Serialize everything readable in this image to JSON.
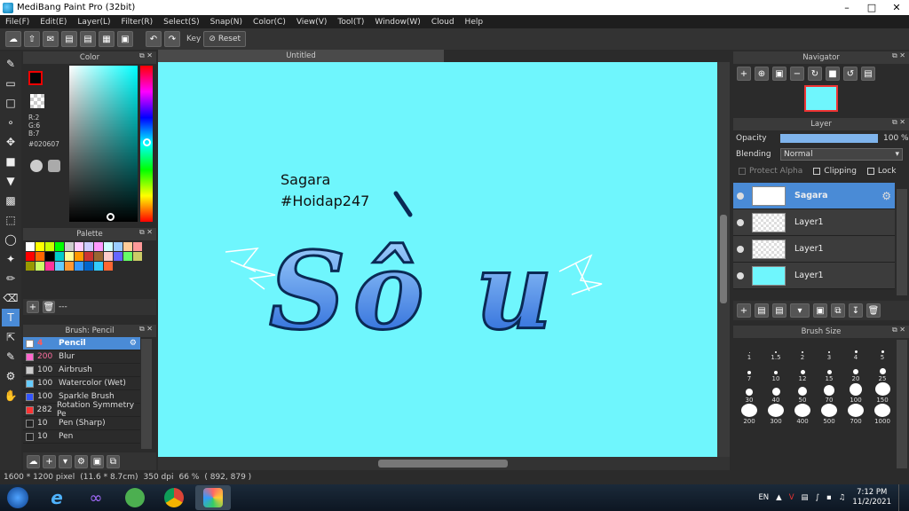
{
  "window": {
    "title": "MediBang Paint Pro (32bit)"
  },
  "menu": [
    "File(F)",
    "Edit(E)",
    "Layer(L)",
    "Filter(R)",
    "Select(S)",
    "Snap(N)",
    "Color(C)",
    "View(V)",
    "Tool(T)",
    "Window(W)",
    "Cloud",
    "Help"
  ],
  "toolbar": {
    "key_label": "Key",
    "reset_label": "Reset"
  },
  "color_panel": {
    "title": "Color",
    "r": "R:2",
    "g": "G:6",
    "b": "B:7",
    "hex": "#020607",
    "fg_color": "#020607"
  },
  "palette_panel": {
    "title": "Palette",
    "footer": "---",
    "swatches": [
      "#ffffff",
      "#ffff00",
      "#ccff00",
      "#00ff00",
      "#cccccc",
      "#ffccff",
      "#ccccff",
      "#ff99ff",
      "#ccffff",
      "#99ccff",
      "#ffcc99",
      "#ff9999",
      "#ff0000",
      "#ff6600",
      "#000000",
      "#00cccc",
      "#ffff99",
      "#ff9900",
      "#cc3333",
      "#996633",
      "#ffcccc",
      "#6666ff",
      "#66ff66",
      "#cccc66",
      "#999900",
      "#ccff66",
      "#ff3399",
      "#66ccff",
      "#ff9933",
      "#3399ff",
      "#0066cc",
      "#33ccff",
      "#ff6633"
    ]
  },
  "brush_panel": {
    "title": "Brush: Pencil",
    "brushes": [
      {
        "size": "4",
        "name": "Pencil",
        "color": "#ffffff"
      },
      {
        "size": "200",
        "name": "Blur",
        "color": "#ff66cc"
      },
      {
        "size": "100",
        "name": "Airbrush",
        "color": "#cccccc"
      },
      {
        "size": "100",
        "name": "Watercolor (Wet)",
        "color": "#66ccff"
      },
      {
        "size": "100",
        "name": "Sparkle Brush",
        "color": "#3355ff"
      },
      {
        "size": "282",
        "name": "Rotation Symmetry Pe",
        "color": "#ff3333"
      },
      {
        "size": "10",
        "name": "Pen (Sharp)",
        "color": "#222222"
      },
      {
        "size": "10",
        "name": "Pen",
        "color": "#222222"
      }
    ]
  },
  "canvas": {
    "tab": "Untitled",
    "bg_color": "#6ff6fd",
    "text_line1": "Sagara",
    "text_line2": "#Hoidap247",
    "art_text": "Sô u"
  },
  "navigator": {
    "title": "Navigator"
  },
  "layer_panel": {
    "title": "Layer",
    "opacity_label": "Opacity",
    "opacity_value": "100 %",
    "opacity": 1.0,
    "blending_label": "Blending",
    "blending_value": "Normal",
    "protect_alpha": "Protect Alpha",
    "clipping": "Clipping",
    "lock": "Lock",
    "layers": [
      {
        "name": "Sagara"
      },
      {
        "name": "Layer1"
      },
      {
        "name": "Layer1"
      },
      {
        "name": "Layer1"
      }
    ]
  },
  "brush_size_panel": {
    "title": "Brush Size",
    "sizes": [
      "1",
      "1.5",
      "2",
      "3",
      "4",
      "5",
      "7",
      "10",
      "12",
      "15",
      "20",
      "25",
      "30",
      "40",
      "50",
      "70",
      "100",
      "150",
      "200",
      "300",
      "400",
      "500",
      "700",
      "1000"
    ]
  },
  "status": {
    "dimensions": "1600 * 1200 pixel",
    "cm": "(11.6 * 8.7cm)",
    "dpi": "350 dpi",
    "zoom": "66 %",
    "coords": "( 892, 879 )"
  },
  "taskbar": {
    "lang": "EN",
    "time": "7:12 PM",
    "date": "11/2/2021"
  }
}
